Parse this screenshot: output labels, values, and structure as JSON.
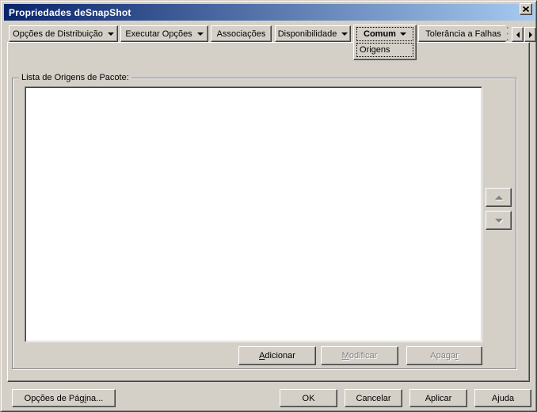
{
  "colors": {
    "titlebar_gradient_start": "#0A246A",
    "titlebar_gradient_end": "#A6CAF0",
    "dialog_face": "#D4D0C8",
    "disabled_text": "#808080"
  },
  "window": {
    "title": "Propriedades deSnapShot"
  },
  "tabs": {
    "distribution": "Opções de Distribuição",
    "execute": "Executar Opções",
    "associations": "Associações",
    "availability": "Disponibilidade",
    "common": "Comum",
    "fault_tolerance": "Tolerância a Falhas",
    "active_tab": "Comum",
    "subtab": "Origens"
  },
  "content": {
    "groupbox_label": "Lista de Origens de Pacote:",
    "list_items": [],
    "add": {
      "pre": "",
      "key": "A",
      "post": "dicionar"
    },
    "modify": {
      "pre": "",
      "key": "M",
      "post": "odificar"
    },
    "delete": {
      "pre": "Apaga",
      "key": "r",
      "post": ""
    }
  },
  "footer": {
    "page_options": {
      "pre": "Opções de Pág",
      "key": "i",
      "post": "na..."
    },
    "ok": "OK",
    "cancel": "Cancelar",
    "apply": "Aplicar",
    "help": {
      "pre": "A",
      "key": "j",
      "post": "uda"
    }
  }
}
